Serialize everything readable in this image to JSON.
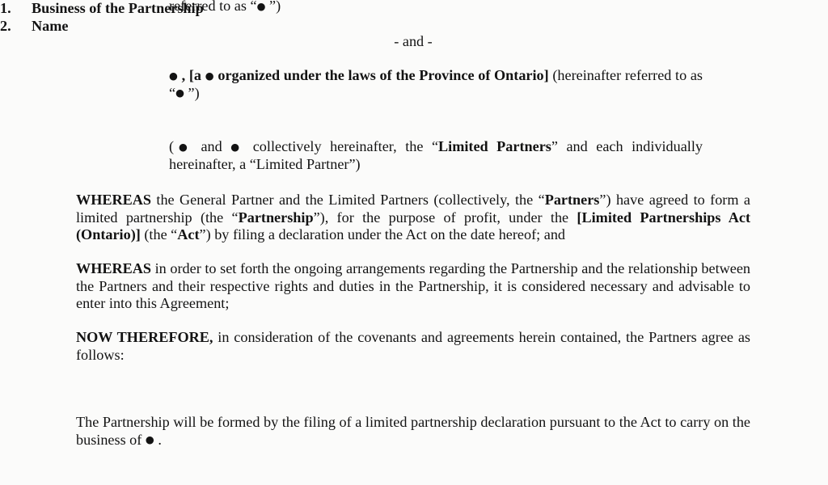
{
  "document": {
    "type": "scanned-legal-agreement",
    "background_color": "#fbfbfa",
    "text_color": "#131313",
    "placeholder_glyph": "●"
  },
  "recitals": {
    "referred_to_as_first": {
      "prefix": "referred to as “",
      "placeholder": "●",
      "suffix": " ”)"
    },
    "and_separator": "- and -",
    "party_b": {
      "placeholder_1": "●",
      "comma": " , ",
      "bracket_open": "[a ",
      "placeholder_2": "●",
      "bold_text": " organized under the laws of the Province of Ontario",
      "bracket_close": "]",
      "tail": " (hereinafter",
      "line2_prefix": "referred to as “",
      "line2_placeholder": "●",
      "line2_suffix": " ”)"
    },
    "collective": {
      "open_paren": "(",
      "placeholder_1": "●",
      "and": " and ",
      "placeholder_2": "●",
      "text_1": " collectively hereinafter, the “",
      "defined_term": "Limited Partners",
      "text_2": "” and each individually hereinafter, a “Limited Partner”)"
    }
  },
  "whereas_clauses": [
    {
      "lead": "WHEREAS",
      "segments": [
        {
          "text": " the General Partner and the Limited Partners (collectively, the “",
          "bold": false
        },
        {
          "text": "Partners",
          "bold": true
        },
        {
          "text": "”) have agreed to form a limited partnership (the “",
          "bold": false
        },
        {
          "text": "Partnership",
          "bold": true
        },
        {
          "text": "”), for the purpose of profit, under the ",
          "bold": false
        },
        {
          "text": "[Limited Partnerships Act (Ontario)]",
          "bold": true
        },
        {
          "text": " (the “",
          "bold": false
        },
        {
          "text": "Act",
          "bold": true
        },
        {
          "text": "”) by filing a declaration under the Act on the date hereof; and",
          "bold": false
        }
      ]
    },
    {
      "lead": "WHEREAS",
      "segments": [
        {
          "text": " in order to set forth the ongoing arrangements regarding the Partnership and the relationship between the Partners and their respective rights and duties in the Partnership, it is considered necessary and advisable to enter into this Agreement;",
          "bold": false
        }
      ]
    }
  ],
  "now_therefore": {
    "lead": "NOW THEREFORE,",
    "text": " in consideration of the covenants and agreements herein contained, the Partners agree as follows:"
  },
  "sections": [
    {
      "number": "1.",
      "title": "Business of the Partnership",
      "body": {
        "text_1": "The Partnership will be formed by the filing of a limited partnership declaration pursuant to the Act to carry on the business of ",
        "placeholder": "●",
        "text_2": " ."
      }
    },
    {
      "number": "2.",
      "title": "Name"
    }
  ]
}
